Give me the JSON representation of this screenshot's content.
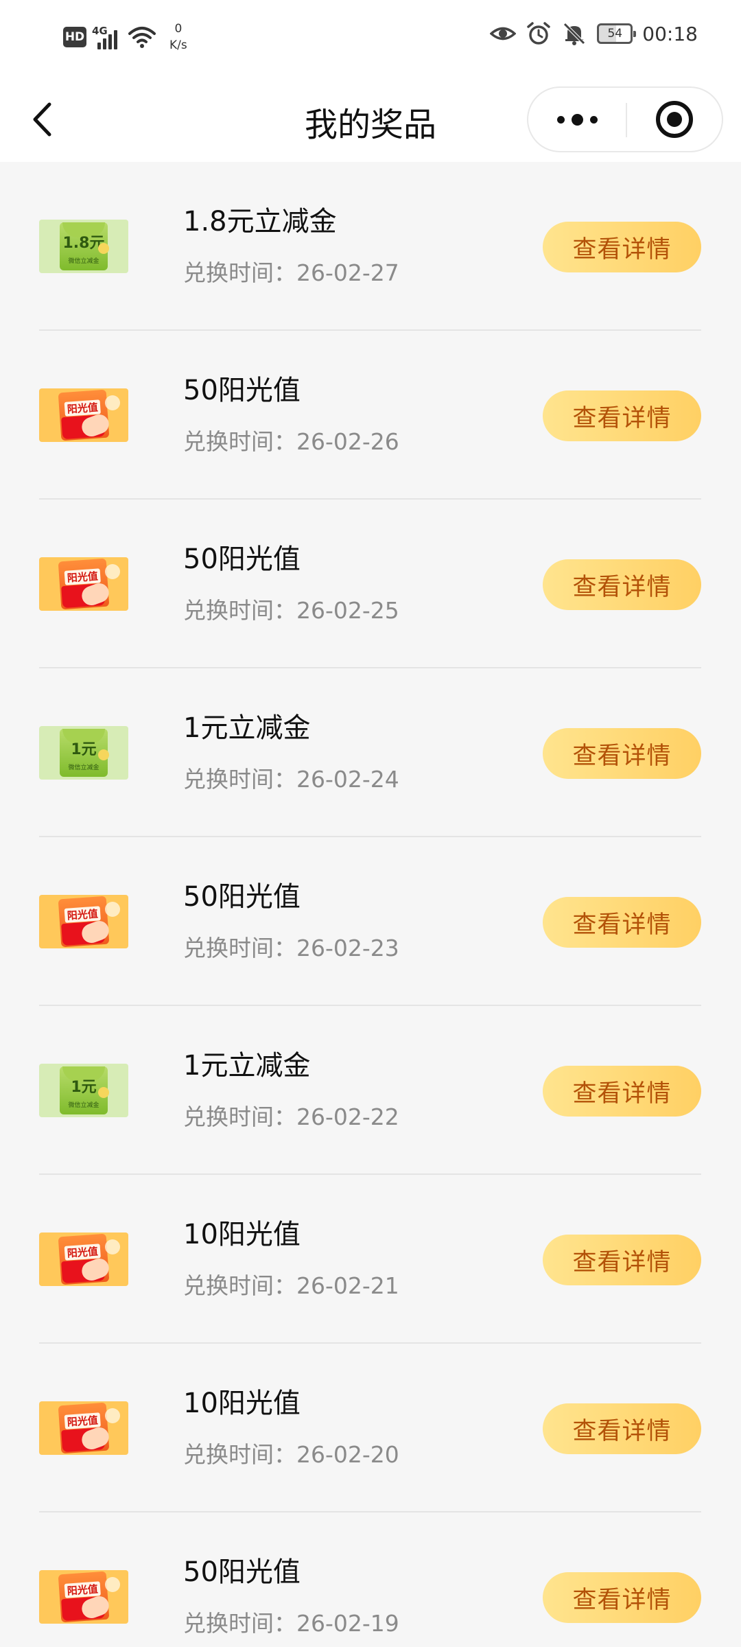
{
  "status_bar": {
    "hd": "HD",
    "network": "4G",
    "net_speed_value": "0",
    "net_speed_unit": "K/s",
    "battery": "54",
    "time": "00:18",
    "icons": [
      "eye-icon",
      "alarm-icon",
      "mute-bell-icon"
    ]
  },
  "header": {
    "title": "我的奖品"
  },
  "prizes": [
    {
      "name": "1.8元立减金",
      "time": "兑换时间：26-02-27",
      "button": "查看详情",
      "kind": "voucher",
      "thumb_label": "1.8元",
      "thumb_sub": "微信立减金"
    },
    {
      "name": "50阳光值",
      "time": "兑换时间：26-02-26",
      "button": "查看详情",
      "kind": "sunshine",
      "thumb_label": "阳光值"
    },
    {
      "name": "50阳光值",
      "time": "兑换时间：26-02-25",
      "button": "查看详情",
      "kind": "sunshine",
      "thumb_label": "阳光值"
    },
    {
      "name": "1元立减金",
      "time": "兑换时间：26-02-24",
      "button": "查看详情",
      "kind": "voucher",
      "thumb_label": "1元",
      "thumb_sub": "微信立减金"
    },
    {
      "name": "50阳光值",
      "time": "兑换时间：26-02-23",
      "button": "查看详情",
      "kind": "sunshine",
      "thumb_label": "阳光值"
    },
    {
      "name": "1元立减金",
      "time": "兑换时间：26-02-22",
      "button": "查看详情",
      "kind": "voucher",
      "thumb_label": "1元",
      "thumb_sub": "微信立减金"
    },
    {
      "name": "10阳光值",
      "time": "兑换时间：26-02-21",
      "button": "查看详情",
      "kind": "sunshine",
      "thumb_label": "阳光值"
    },
    {
      "name": "10阳光值",
      "time": "兑换时间：26-02-20",
      "button": "查看详情",
      "kind": "sunshine",
      "thumb_label": "阳光值"
    },
    {
      "name": "50阳光值",
      "time": "兑换时间：26-02-19",
      "button": "查看详情",
      "kind": "sunshine",
      "thumb_label": "阳光值"
    }
  ],
  "colors": {
    "button_bg": "#ffd064",
    "button_text": "#b35208",
    "page_bg": "#f6f6f6"
  }
}
